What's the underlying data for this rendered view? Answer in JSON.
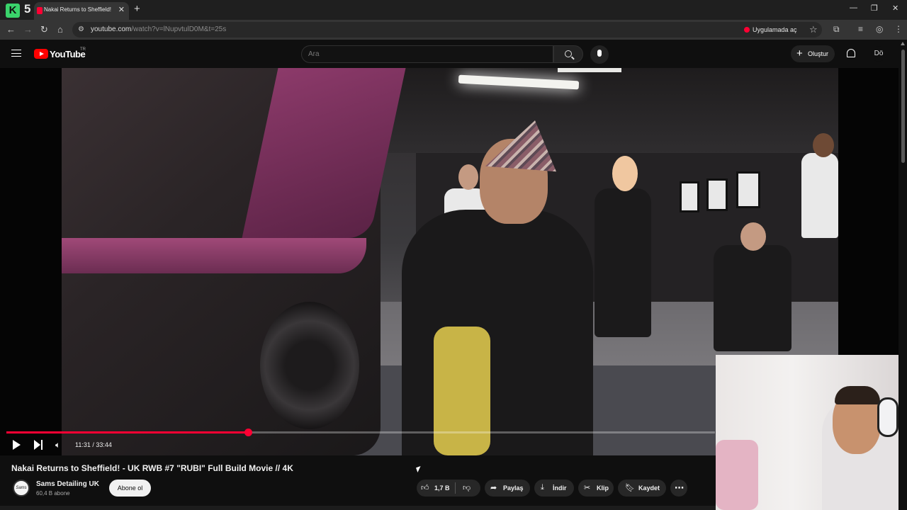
{
  "browser": {
    "app_number": "5",
    "app_logo": "K",
    "tab_title": "Nakai Returns to Sheffield! - UK",
    "url_host": "youtube.com",
    "url_rest": "/watch?v=lNupvtulD0M&t=25s",
    "open_in_app": "Uygulamada aç"
  },
  "youtube": {
    "logo_text": "YouTube",
    "region": "TR",
    "search_placeholder": "Ara",
    "create_label": "Oluştur",
    "avatar_initials": "Dö"
  },
  "player": {
    "time": "11:31 / 33:44",
    "progress_fraction": 0.3412
  },
  "video": {
    "title": "Nakai Returns to Sheffield! - UK RWB #7 \"RUBI\" Full Build Movie // 4K",
    "channel": "Sams Detailing UK",
    "subscribers": "60,4 B abone",
    "subscribe_label": "Abone ol",
    "channel_avatar_text": "Sams"
  },
  "actions": {
    "likes": "1,7 B",
    "share": "Paylaş",
    "download": "İndir",
    "clip": "Klip",
    "save": "Kaydet",
    "more": "⋯"
  },
  "colors": {
    "accent": "#ff0033",
    "background": "#0f0f0f"
  }
}
